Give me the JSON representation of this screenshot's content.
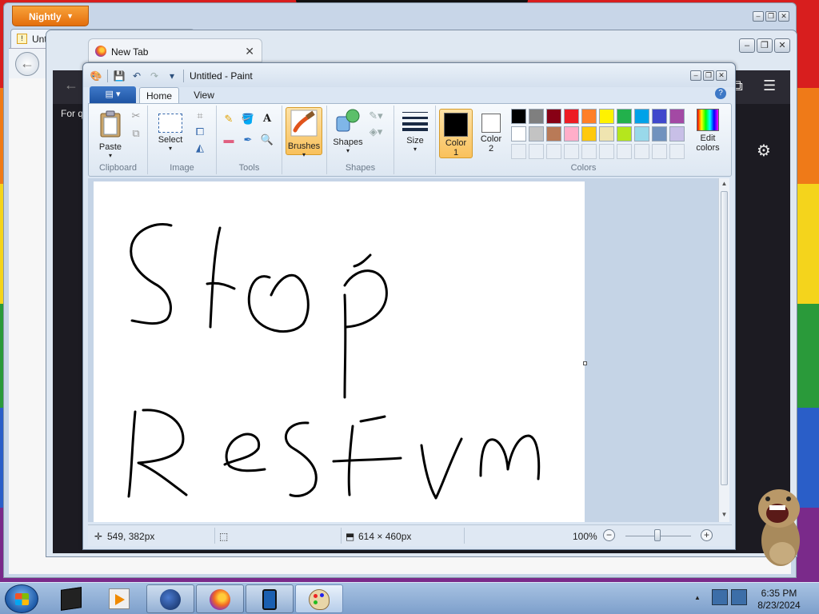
{
  "nightly": {
    "menu_label": "Nightly",
    "tab_title": "Unt",
    "window_controls": [
      "minimize",
      "restore",
      "close"
    ]
  },
  "firefox": {
    "tab_title": "New Tab",
    "bookmark_text": "For q"
  },
  "paint": {
    "title": "Untitled - Paint",
    "tabs": [
      "Home",
      "View"
    ],
    "groups": {
      "clipboard": {
        "label": "Clipboard",
        "paste": "Paste"
      },
      "image": {
        "label": "Image",
        "select": "Select"
      },
      "tools": {
        "label": "Tools"
      },
      "brushes": {
        "label": "Brushes"
      },
      "shapes": {
        "label": "Shapes",
        "shapes_btn": "Shapes"
      },
      "size": {
        "label": "Size"
      },
      "colors": {
        "label": "Colors",
        "color1_line1": "Color",
        "color1_line2": "1",
        "color2_line1": "Color",
        "color2_line2": "2",
        "edit_line1": "Edit",
        "edit_line2": "colors",
        "color1": "#000000",
        "color2": "#ffffff",
        "palette": [
          "#000000",
          "#7f7f7f",
          "#880015",
          "#ed1c24",
          "#ff7f27",
          "#fff200",
          "#22b14c",
          "#00a2e8",
          "#3f48cc",
          "#a349a4",
          "#ffffff",
          "#c3c3c3",
          "#b97a57",
          "#ffaec9",
          "#ffc90e",
          "#efe4b0",
          "#b5e61d",
          "#99d9ea",
          "#7092be",
          "#c8bfe7"
        ]
      }
    },
    "canvas_strokes": [
      "M97,55 C80,50 55,58 48,78 C42,100 58,118 80,130 C98,142 100,162 92,172 C80,182 60,176 48,174",
      "M158,58 C150,90 148,140 146,182",
      "M142,128 C152,126 164,128 176,134",
      "M220,120 C200,112 190,140 196,160 C204,188 246,196 262,178 C274,160 268,126 252,118 C240,114 228,128 222,142",
      "M314,142 C316,190 314,230 314,270",
      "M314,130 C330,104 362,106 366,134 C370,162 344,180 316,182",
      "M326,106 C334,104 340,98 346,92",
      "M52,288 C48,330 48,360 44,394",
      "M62,286 C90,284 112,300 112,322 C112,344 82,350 56,352 C76,360 100,380 116,392",
      "M164,354 C176,348 198,346 206,334 C210,320 196,312 184,318 C166,326 162,346 170,356 C182,364 200,362 214,360",
      "M268,302 C240,300 232,324 250,334 C270,346 284,362 276,382 C266,396 250,394 246,392",
      "M324,306 C320,340 318,370 320,392",
      "M300,350 C330,348 360,348 384,346",
      "M334,300 C344,298 356,296 364,294",
      "M410,330 C414,360 420,382 428,396 C436,380 446,350 460,322",
      "M484,368 C484,350 486,330 494,324 C504,318 516,334 518,360 C522,336 532,318 544,318 C556,320 558,350 556,372"
    ],
    "status": {
      "cursor_pos": "549, 382px",
      "canvas_size": "614 × 460px",
      "zoom": "100%"
    }
  },
  "taskbar": {
    "time": "6:35 PM",
    "date": "8/23/2024"
  }
}
